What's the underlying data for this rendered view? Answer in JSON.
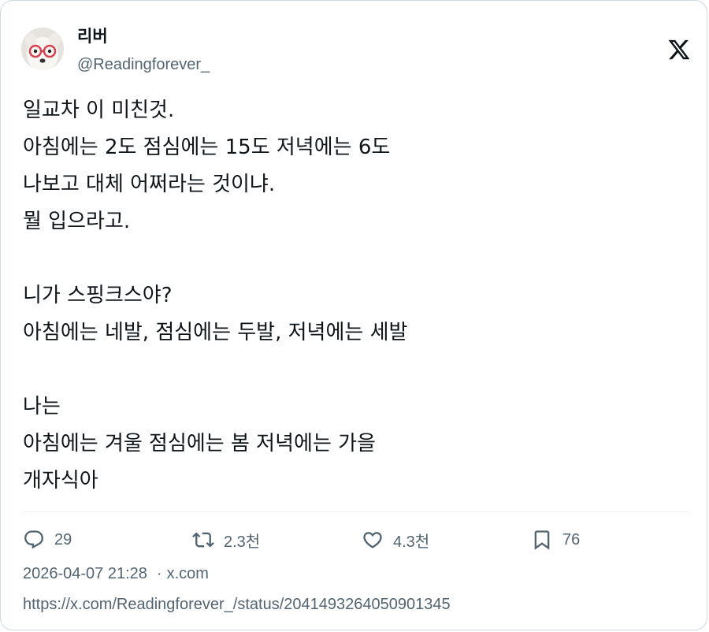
{
  "author": {
    "display_name": "리버",
    "handle": "@Readingforever_",
    "avatar_icon": "avatar-dog-with-red-glasses"
  },
  "platform_icon": "x-logo-icon",
  "tweet": {
    "lines": [
      "일교차 이 미친것.",
      "아침에는 2도 점심에는 15도 저녁에는 6도",
      "나보고 대체 어쩌라는 것이냐.",
      "뭘 입으라고.",
      "",
      "니가 스핑크스야?",
      "아침에는 네발, 점심에는 두발, 저녁에는 세발",
      "",
      "나는",
      "아침에는 겨울 점심에는 봄 저녁에는 가을",
      "개자식아"
    ]
  },
  "actions": {
    "replies": "29",
    "retweets": "2.3천",
    "likes": "4.3천",
    "bookmarks": "76"
  },
  "meta": {
    "timestamp": "2026-04-07 21:28",
    "separator": "·",
    "source": "x.com"
  },
  "url": "https://x.com/Readingforever_/status/2041493264050901345",
  "colors": {
    "text": "#0f1419",
    "secondary": "#536471",
    "border": "#cfd9de"
  }
}
